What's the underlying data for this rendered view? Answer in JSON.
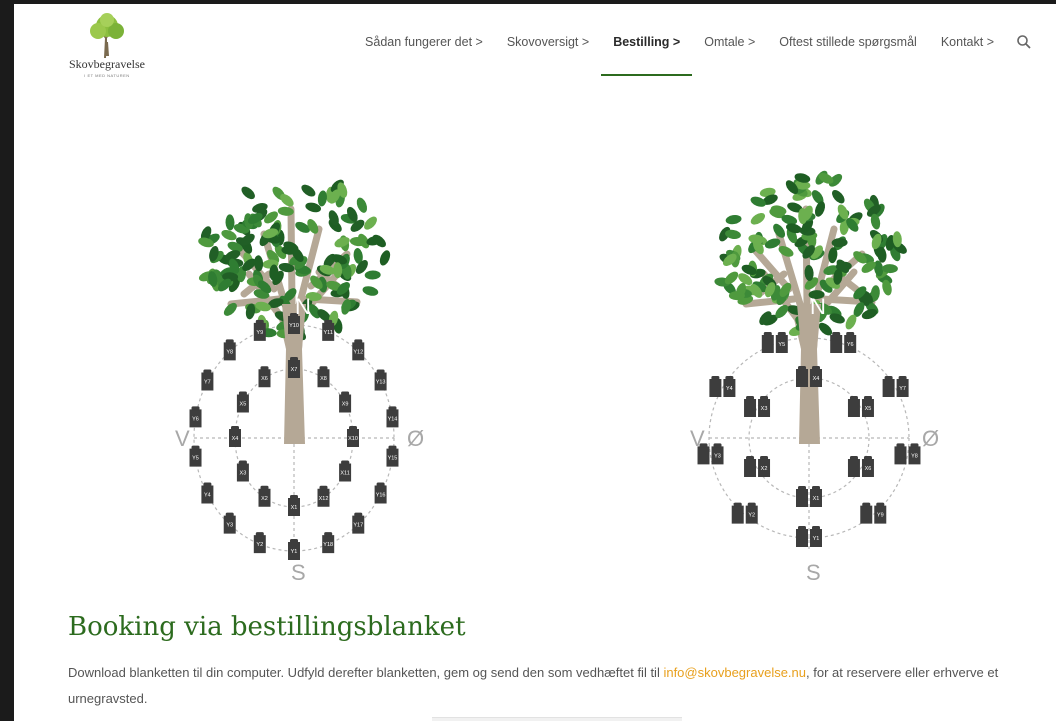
{
  "logo": {
    "title": "Skovbegravelse",
    "tagline": "I ET MED NATUREN"
  },
  "nav": {
    "items": [
      {
        "label": "Sådan fungerer det >",
        "active": false
      },
      {
        "label": "Skovoversigt >",
        "active": false
      },
      {
        "label": "Bestilling >",
        "active": true
      },
      {
        "label": "Omtale >",
        "active": false
      },
      {
        "label": "Oftest stillede spørgsmål",
        "active": false
      },
      {
        "label": "Kontakt >",
        "active": false
      }
    ]
  },
  "diagrams": {
    "compass": {
      "north": "N",
      "south": "S",
      "west": "V",
      "east": "Ø"
    },
    "left": {
      "urns": [
        "Y1",
        "Y2",
        "Y3",
        "Y4",
        "Y5",
        "Y6",
        "Y7",
        "Y8",
        "Y9",
        "Y10",
        "Y11",
        "Y12",
        "Y13",
        "Y14",
        "Y15",
        "Y16",
        "Y17",
        "Y18",
        "X1",
        "X2",
        "X3",
        "X4",
        "X5",
        "X6",
        "X7",
        "X8",
        "X9",
        "X10",
        "X11",
        "X12"
      ]
    },
    "right": {
      "urns": [
        "Y1",
        "Y2",
        "Y3",
        "Y4",
        "Y5",
        "Y6",
        "Y7",
        "Y8",
        "Y9",
        "X1",
        "X2",
        "X3",
        "X4",
        "X5",
        "X6"
      ]
    }
  },
  "booking": {
    "title": "Booking via bestillingsblanket",
    "text_before": "Download blanketten til din computer. Udfyld derefter blanketten, gem og send den som vedhæftet fil til ",
    "email": "info@skovbegravelse.nu",
    "text_after": ", for at reservere eller erhverve et urnegravsted."
  },
  "colors": {
    "brand_green": "#2c6b1e",
    "link_orange": "#e8a01e",
    "trunk": "#b5a896",
    "urn": "#3d3d3d"
  }
}
